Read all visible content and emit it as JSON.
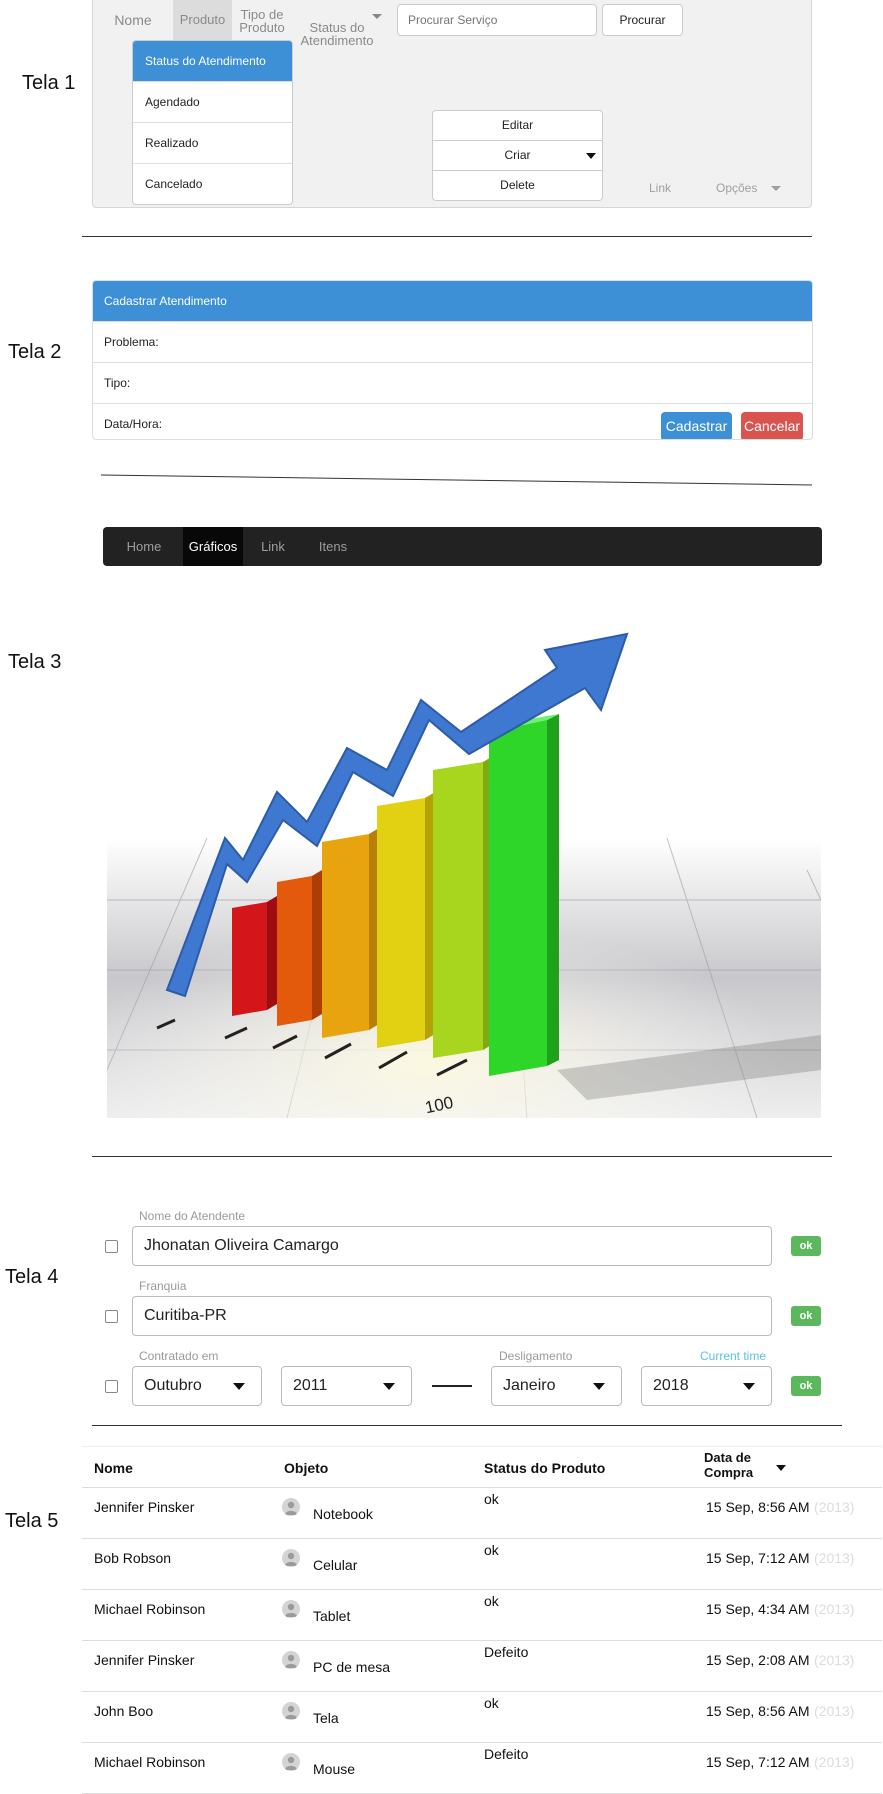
{
  "labels": {
    "tela1": "Tela 1",
    "tela2": "Tela 2",
    "tela3": "Tela 3",
    "tela4": "Tela 4",
    "tela5": "Tela 5"
  },
  "tela1": {
    "nav": [
      "Nome",
      "Produto",
      "Tipo de\nProduto",
      "Status do\nAtendimento"
    ],
    "search_placeholder": "Procurar Serviço",
    "search_button": "Procurar",
    "dropdown": [
      "Status do Atendimento",
      "Agendado",
      "Realizado",
      "Cancelado"
    ],
    "group": [
      "Editar",
      "Criar",
      "Delete"
    ],
    "link": "Link",
    "options": "Opções"
  },
  "tela2": {
    "title": "Cadastrar Atendimento",
    "fields": [
      "Problema:",
      "Tipo:",
      "Data/Hora:"
    ],
    "submit": "Cadastrar",
    "cancel": "Cancelar",
    "colors": {
      "primary": "#3d8fd6",
      "danger": "#d9534f"
    }
  },
  "tela3": {
    "nav": [
      "Home",
      "Gráficos",
      "Link",
      "Itens"
    ],
    "image": {
      "visible_text": "100",
      "bar_colors": [
        "#d3161a",
        "#e35a0c",
        "#e8a40e",
        "#e2d012",
        "#a8d61e",
        "#2fd62a"
      ]
    }
  },
  "tela4": {
    "attendant_label": "Nome do Atendente",
    "attendant_value": "Jhonatan Oliveira Camargo",
    "franchise_label": "Franquia",
    "franchise_value": "Curitiba-PR",
    "hired_label": "Contratado em",
    "hired_month": "Outubro",
    "hired_year": "2011",
    "dismissal_label": "Desligamento",
    "current_time": "Current time",
    "dismissal_month": "Janeiro",
    "dismissal_year": "2018",
    "ok": "ok"
  },
  "tela5": {
    "headers": [
      "Nome",
      "Objeto",
      "Status do Produto",
      "Data de\nCompra"
    ],
    "rows": [
      {
        "nome": "Jennifer Pinsker",
        "objeto": "Notebook",
        "status": "ok",
        "data": "15 Sep, 8:56 AM",
        "ano": "(2013)"
      },
      {
        "nome": "Bob Robson",
        "objeto": "Celular",
        "status": "ok",
        "data": "15 Sep, 7:12 AM",
        "ano": "(2013)"
      },
      {
        "nome": "Michael Robinson",
        "objeto": "Tablet",
        "status": "ok",
        "data": "15 Sep, 4:34 AM",
        "ano": "(2013)"
      },
      {
        "nome": "Jennifer Pinsker",
        "objeto": "PC de mesa",
        "status": "Defeito",
        "data": "15 Sep, 2:08 AM",
        "ano": "(2013)"
      },
      {
        "nome": "John Boo",
        "objeto": "Tela",
        "status": "ok",
        "data": "15 Sep, 8:56 AM",
        "ano": "(2013)"
      },
      {
        "nome": "Michael Robinson",
        "objeto": "Mouse",
        "status": "Defeito",
        "data": "15 Sep, 7:12 AM",
        "ano": "(2013)"
      }
    ]
  }
}
